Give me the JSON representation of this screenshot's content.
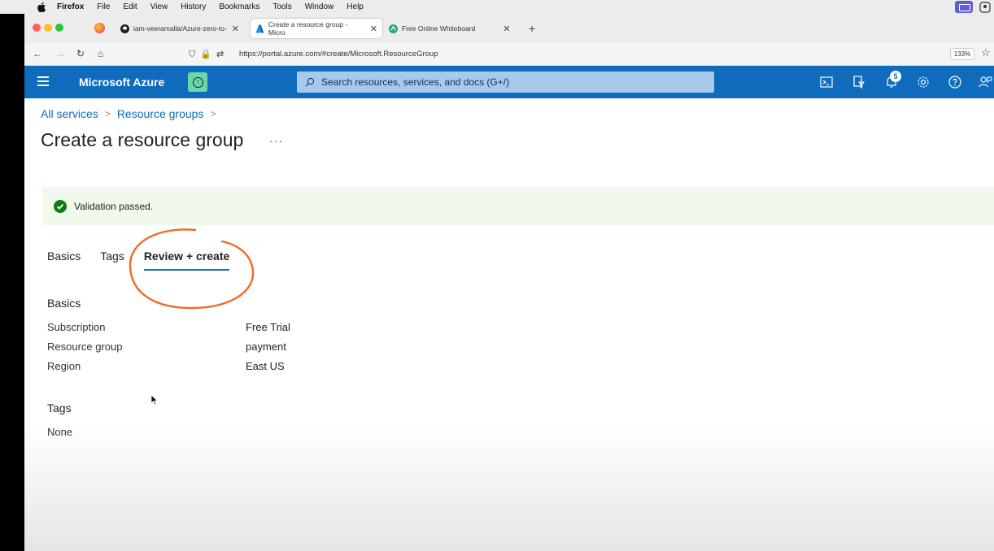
{
  "mac_menubar": {
    "app": "Firefox",
    "items": [
      "File",
      "Edit",
      "View",
      "History",
      "Bookmarks",
      "Tools",
      "Window",
      "Help"
    ]
  },
  "browser": {
    "tabs": [
      {
        "title": "iam-veeramalla/Azure-zero-to-",
        "icon": "github-icon"
      },
      {
        "title": "Create a resource group - Micro",
        "icon": "azure-icon",
        "active": true
      },
      {
        "title": "Free Online Whiteboard",
        "icon": "whiteboard-icon"
      }
    ],
    "url": "https://portal.azure.com/#create/Microsoft.ResourceGroup",
    "zoom": "133%"
  },
  "azure": {
    "brand": "Microsoft Azure",
    "search_placeholder": "Search resources, services, and docs (G+/)",
    "notification_count": "5",
    "accent": "#0f6cbd"
  },
  "breadcrumb": [
    "All services",
    "Resource groups"
  ],
  "page": {
    "title": "Create a resource group",
    "more": "···"
  },
  "validation": {
    "message": "Validation passed.",
    "status_color": "#107c10"
  },
  "tabs": [
    {
      "label": "Basics"
    },
    {
      "label": "Tags"
    },
    {
      "label": "Review + create",
      "active": true
    }
  ],
  "review": {
    "basics_heading": "Basics",
    "fields": [
      {
        "label": "Subscription",
        "value": "Free Trial"
      },
      {
        "label": "Resource group",
        "value": "payment"
      },
      {
        "label": "Region",
        "value": "East US"
      }
    ],
    "tags_heading": "Tags",
    "tags_value": "None"
  }
}
